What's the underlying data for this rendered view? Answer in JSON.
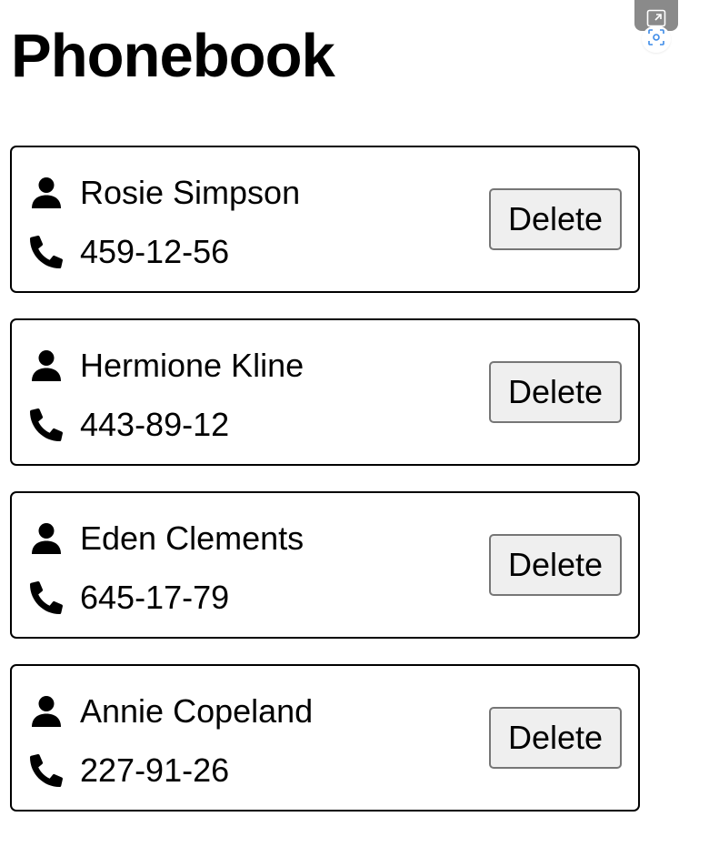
{
  "header": {
    "title": "Phonebook"
  },
  "toolbar": {
    "tab_icon": "window-tab-icon",
    "scan_icon": "scan-icon"
  },
  "contacts": [
    {
      "name": "Rosie Simpson",
      "phone": "459-12-56",
      "delete_label": "Delete"
    },
    {
      "name": "Hermione Kline",
      "phone": "443-89-12",
      "delete_label": "Delete"
    },
    {
      "name": "Eden Clements",
      "phone": "645-17-79",
      "delete_label": "Delete"
    },
    {
      "name": "Annie Copeland",
      "phone": "227-91-26",
      "delete_label": "Delete"
    }
  ],
  "icons": {
    "name": "user-icon",
    "phone": "phone-icon"
  },
  "colors": {
    "text": "#000000",
    "border": "#000000",
    "button_bg": "#efefef",
    "button_border": "#767676",
    "tab_bg": "#8a8a8a"
  }
}
